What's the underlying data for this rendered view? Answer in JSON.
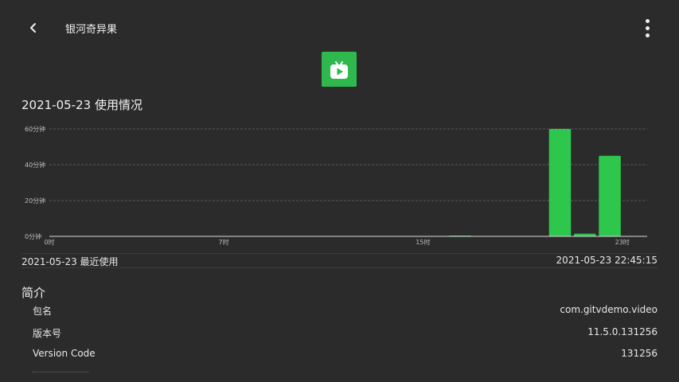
{
  "header": {
    "title": "银河奇异果",
    "back_icon": "chevron-left-icon",
    "menu_icon": "more-vertical-icon"
  },
  "app_icon": {
    "name": "app-logo-icon",
    "color": "#2fb84e"
  },
  "usage": {
    "title": "2021-05-23 使用情况"
  },
  "chart_data": {
    "type": "bar",
    "x": [
      16,
      20,
      21,
      22
    ],
    "values": [
      0.3,
      60,
      1.5,
      45
    ],
    "x_range": [
      0,
      23
    ],
    "x_ticks": [
      "0时",
      "7时",
      "15时",
      "23时"
    ],
    "y_ticks": [
      "0分钟",
      "20分钟",
      "40分钟",
      "60分钟"
    ],
    "ylim": [
      0,
      60
    ],
    "bar_color": "#2ec74d",
    "grid": true
  },
  "recent": {
    "label": "2021-05-23 最近使用",
    "time": "2021-05-23 22:45:15"
  },
  "intro": {
    "title": "简介",
    "rows": [
      {
        "key": "包名",
        "value": "com.gitvdemo.video"
      },
      {
        "key": "版本号",
        "value": "11.5.0.131256"
      },
      {
        "key": "Version Code",
        "value": "131256"
      }
    ]
  }
}
